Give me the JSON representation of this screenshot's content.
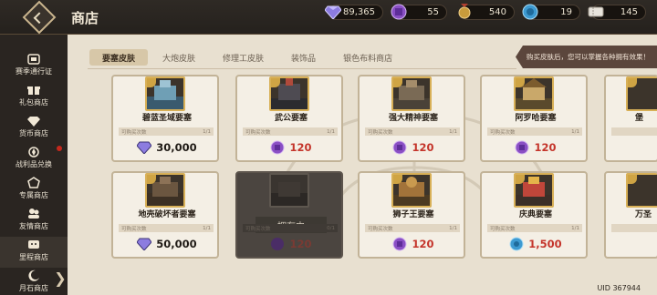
{
  "header": {
    "title": "商店",
    "currencies": [
      {
        "icon": "gem-icon",
        "value": "89,365"
      },
      {
        "icon": "purple-coin-icon",
        "value": "55"
      },
      {
        "icon": "medal-icon",
        "value": "540"
      },
      {
        "icon": "blue-token-icon",
        "value": "19"
      },
      {
        "icon": "ticket-icon",
        "value": "145"
      }
    ]
  },
  "sidebar": {
    "items": [
      {
        "label": "赛季通行证",
        "icon": "pass-icon"
      },
      {
        "label": "礼包商店",
        "icon": "gift-icon"
      },
      {
        "label": "货币商店",
        "icon": "gem-icon"
      },
      {
        "label": "战利品兑换",
        "icon": "loot-icon"
      },
      {
        "label": "专属商店",
        "icon": "exclusive-icon"
      },
      {
        "label": "友情商店",
        "icon": "friend-icon"
      },
      {
        "label": "里程商店",
        "icon": "mileage-icon"
      },
      {
        "label": "月石商店",
        "icon": "moonstone-icon"
      }
    ]
  },
  "tabs": [
    "要塞皮肤",
    "大炮皮肤",
    "修理工皮肤",
    "装饰品",
    "银色布料商店"
  ],
  "tip": "购买皮肤后，您可以掌握各种拥有效果！",
  "labels": {
    "limit": "可购买次数",
    "owned": "拥有中"
  },
  "cards": [
    {
      "name": "碧蓝圣域要塞",
      "limit": "1/1",
      "price": "30,000",
      "currency": "gem-icon",
      "owned": false
    },
    {
      "name": "武公要塞",
      "limit": "1/1",
      "price": "120",
      "currency": "purple-coin-icon",
      "owned": false
    },
    {
      "name": "强大精神要塞",
      "limit": "1/1",
      "price": "120",
      "currency": "purple-coin-icon",
      "owned": false
    },
    {
      "name": "阿罗哈要塞",
      "limit": "1/1",
      "price": "120",
      "currency": "purple-coin-icon",
      "owned": false
    },
    {
      "name": "堡",
      "limit": "",
      "price": "",
      "currency": "",
      "owned": false
    },
    {
      "name": "地壳破坏者要塞",
      "limit": "1/1",
      "price": "50,000",
      "currency": "gem-icon",
      "owned": false
    },
    {
      "name": "",
      "limit": "0/1",
      "price": "120",
      "currency": "purple-coin-icon",
      "owned": true
    },
    {
      "name": "狮子王要塞",
      "limit": "1/1",
      "price": "120",
      "currency": "purple-coin-icon",
      "owned": false
    },
    {
      "name": "庆典要塞",
      "limit": "1/1",
      "price": "1,500",
      "currency": "blue-token-icon",
      "owned": false
    },
    {
      "name": "万圣",
      "limit": "",
      "price": "",
      "currency": "",
      "owned": false
    }
  ],
  "uid": "UID 367944",
  "colors": {
    "gem": "#8c7ce0",
    "purple_coin": "#8a4fc4",
    "blue_token": "#3d9ad1",
    "price_red": "#c4342a",
    "gold": "#d8b057"
  }
}
